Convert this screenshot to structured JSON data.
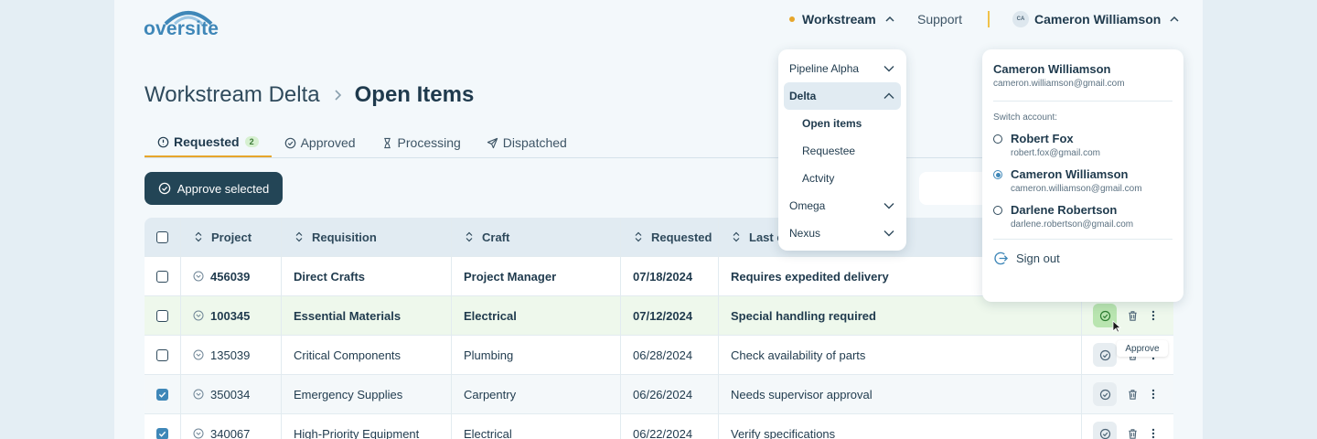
{
  "header": {
    "logo": "oversite",
    "workstream_label": "Workstream",
    "support_label": "Support",
    "user_initials": "CA",
    "user_name": "Cameron Williamson"
  },
  "breadcrumb": {
    "parent": "Workstream Delta",
    "current": "Open Items"
  },
  "tabs": [
    {
      "label": "Requested",
      "badge": "2",
      "icon": "alert-circle-icon",
      "active": true
    },
    {
      "label": "Approved",
      "icon": "check-circle-icon"
    },
    {
      "label": "Processing",
      "icon": "hourglass-icon"
    },
    {
      "label": "Dispatched",
      "icon": "send-icon"
    }
  ],
  "toolbar": {
    "approve_selected": "Approve selected"
  },
  "table": {
    "columns": [
      "Project",
      "Requisition",
      "Craft",
      "Requested",
      "Last c"
    ],
    "rows": [
      {
        "project": "456039",
        "requisition": "Direct Crafts",
        "craft": "Project Manager",
        "requested": "07/18/2024",
        "note": "Requires expedited delivery",
        "checked": false,
        "bold": true
      },
      {
        "project": "100345",
        "requisition": "Essential Materials",
        "craft": "Electrical",
        "requested": "07/12/2024",
        "note": "Special handling required",
        "checked": false,
        "bold": true,
        "highlighted": true
      },
      {
        "project": "135039",
        "requisition": "Critical Components",
        "craft": "Plumbing",
        "requested": "06/28/2024",
        "note": "Check availability of parts",
        "checked": false
      },
      {
        "project": "350034",
        "requisition": "Emergency Supplies",
        "craft": "Carpentry",
        "requested": "06/26/2024",
        "note": "Needs supervisor approval",
        "checked": true
      },
      {
        "project": "340067",
        "requisition": "High-Priority Equipment",
        "craft": "Electrical",
        "requested": "06/22/2024",
        "note": "Verify specifications",
        "checked": true
      }
    ]
  },
  "tooltip": "Approve",
  "workstream_menu": {
    "items": [
      {
        "label": "Pipeline Alpha"
      },
      {
        "label": "Delta",
        "expanded": true
      },
      {
        "label": "Open items",
        "sub": true,
        "current": true
      },
      {
        "label": "Requestee",
        "sub": true
      },
      {
        "label": "Actvity",
        "sub": true
      },
      {
        "label": "Omega"
      },
      {
        "label": "Nexus"
      }
    ]
  },
  "user_menu": {
    "name": "Cameron Williamson",
    "email": "cameron.williamson@gmail.com",
    "switch_label": "Switch account:",
    "accounts": [
      {
        "name": "Robert Fox",
        "email": "robert.fox@gmail.com",
        "selected": false
      },
      {
        "name": "Cameron Williamson",
        "email": "cameron.williamson@gmail.com",
        "selected": true
      },
      {
        "name": "Darlene Robertson",
        "email": "darlene.robertson@gmail.com",
        "selected": false
      }
    ],
    "sign_out": "Sign out"
  },
  "colors": {
    "primary": "#234556",
    "accent": "#e7a62b",
    "brand": "#3f87b8",
    "success_bg": "#b9e5b0"
  }
}
